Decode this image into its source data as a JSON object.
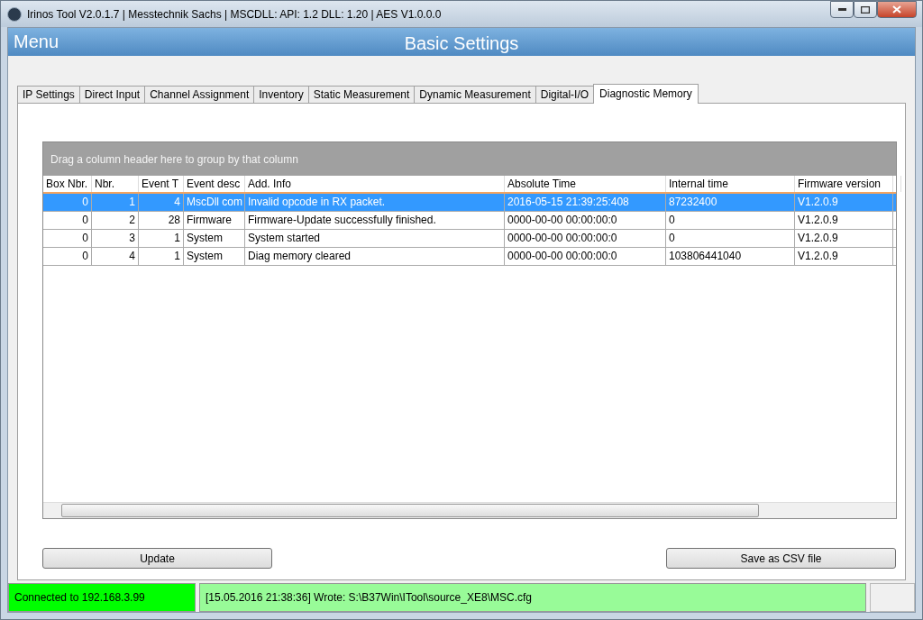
{
  "window": {
    "title": "Irinos Tool V2.0.1.7 | Messtechnik Sachs | MSCDLL: API: 1.2 DLL: 1.20 | AES V1.0.0.0"
  },
  "header": {
    "menu": "Menu",
    "title": "Basic Settings"
  },
  "tabs": [
    {
      "label": "IP Settings",
      "selected": false
    },
    {
      "label": "Direct Input",
      "selected": false
    },
    {
      "label": "Channel Assignment",
      "selected": false
    },
    {
      "label": "Inventory",
      "selected": false
    },
    {
      "label": "Static Measurement",
      "selected": false
    },
    {
      "label": "Dynamic Measurement",
      "selected": false
    },
    {
      "label": "Digital-I/O",
      "selected": false
    },
    {
      "label": "Diagnostic Memory",
      "selected": true
    }
  ],
  "grid": {
    "group_hint": "Drag a column header here to group by that column",
    "columns": [
      {
        "label": "Box Nbr.",
        "kind": "number"
      },
      {
        "label": "Nbr.",
        "kind": "number"
      },
      {
        "label": "Event T",
        "kind": "number"
      },
      {
        "label": "Event desc",
        "kind": "text"
      },
      {
        "label": "Add. Info",
        "kind": "text"
      },
      {
        "label": "Absolute Time",
        "kind": "text"
      },
      {
        "label": "Internal time",
        "kind": "text"
      },
      {
        "label": "Firmware version",
        "kind": "text"
      }
    ],
    "rows": [
      {
        "selected": true,
        "cells": [
          "0",
          "1",
          "4",
          "MscDll com",
          "Invalid opcode in RX packet.",
          "2016-05-15 21:39:25:408",
          "87232400",
          "V1.2.0.9"
        ]
      },
      {
        "selected": false,
        "cells": [
          "0",
          "2",
          "28",
          "Firmware",
          "Firmware-Update successfully finished.",
          "0000-00-00 00:00:00:0",
          "0",
          "V1.2.0.9"
        ]
      },
      {
        "selected": false,
        "cells": [
          "0",
          "3",
          "1",
          "System",
          "System started",
          "0000-00-00 00:00:00:0",
          "0",
          "V1.2.0.9"
        ]
      },
      {
        "selected": false,
        "cells": [
          "0",
          "4",
          "1",
          "System",
          "Diag memory cleared",
          "0000-00-00 00:00:00:0",
          "103806441040",
          "V1.2.0.9"
        ]
      }
    ]
  },
  "buttons": [
    "Update",
    "Save as CSV file"
  ],
  "status_bar": {
    "connection": "Connected to 192.168.3.99",
    "message": "[15.05.2016 21:38:36] Wrote: S:\\B37Win\\ITool\\source_XE8\\MSC.cfg"
  }
}
